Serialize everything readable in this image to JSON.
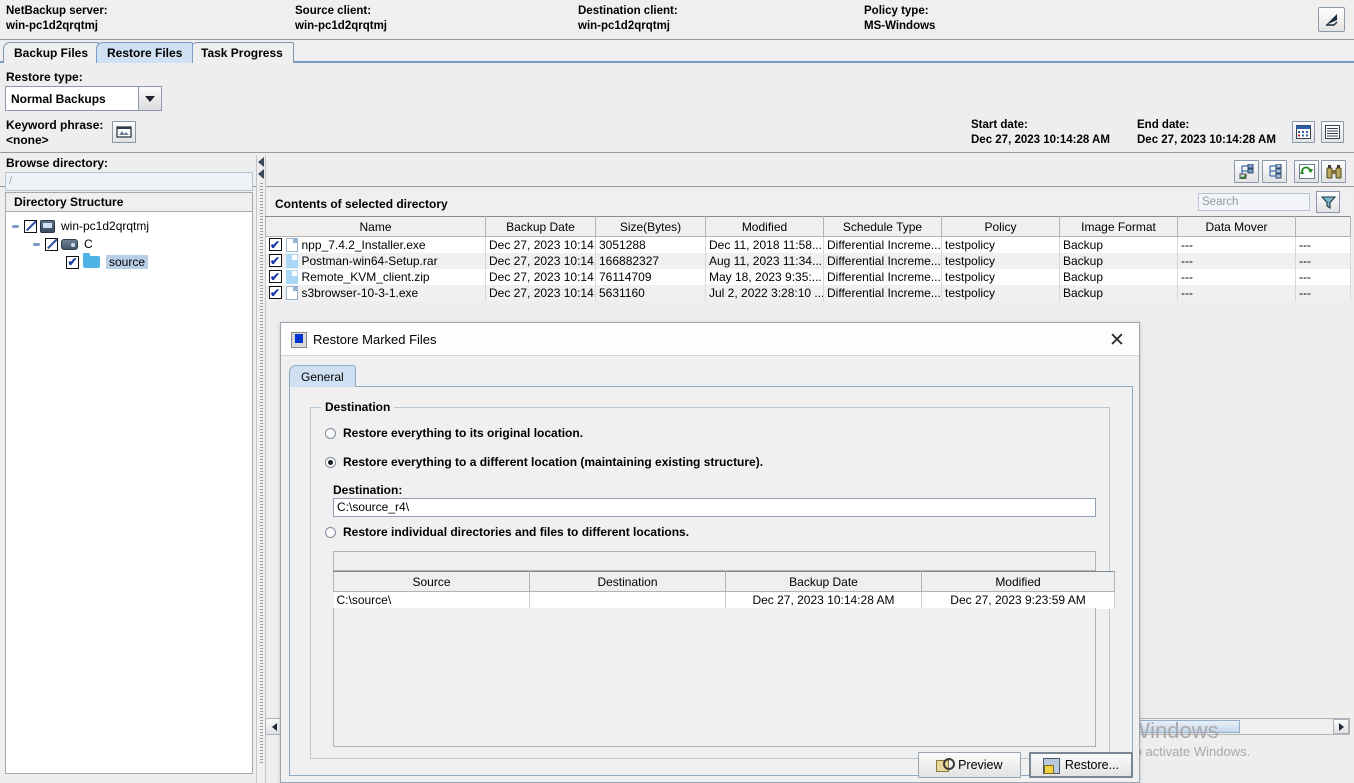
{
  "header": {
    "fields": [
      {
        "label": "NetBackup server:",
        "value": "win-pc1d2qrqtmj"
      },
      {
        "label": "Source client:",
        "value": "win-pc1d2qrqtmj"
      },
      {
        "label": "Destination client:",
        "value": "win-pc1d2qrqtmj"
      },
      {
        "label": "Policy type:",
        "value": "MS-Windows"
      }
    ],
    "expand_icon": "expand-arrow-icon"
  },
  "tabs": [
    {
      "label": "Backup Files",
      "active": false
    },
    {
      "label": "Restore Files",
      "active": true
    },
    {
      "label": "Task Progress",
      "active": false
    }
  ],
  "restore_type": {
    "label": "Restore type:",
    "selected": "Normal Backups",
    "options": [
      "Normal Backups"
    ]
  },
  "keyword": {
    "label": "Keyword phrase:",
    "value": "<none>",
    "button_icon": "keyword-icon"
  },
  "dates": {
    "start_label": "Start date:",
    "start_value": "Dec 27, 2023 10:14:28 AM",
    "end_label": "End date:",
    "end_value": "Dec 27, 2023 10:14:28 AM",
    "calendar_icon": "calendar-icon",
    "list_icon": "date-list-icon"
  },
  "toolbar": {
    "buttons": [
      "select-all-icon",
      "deselect-all-icon",
      "refresh-icon",
      "search-binoculars-icon"
    ]
  },
  "browse": {
    "label": "Browse directory:",
    "value": "/",
    "tree_header": "Directory Structure",
    "tree": [
      {
        "label": "win-pc1d2qrqtmj",
        "icon": "computer-icon",
        "state": "partial",
        "depth": 0,
        "selected": false
      },
      {
        "label": "C",
        "icon": "drive-icon",
        "state": "partial",
        "depth": 1,
        "selected": false
      },
      {
        "label": "source",
        "icon": "folder-icon",
        "state": "checked",
        "depth": 2,
        "selected": true
      }
    ]
  },
  "contents": {
    "title": "Contents of selected directory",
    "search_placeholder": "Search",
    "filter_icon": "filter-funnel-icon",
    "columns": [
      "Name",
      "Backup Date",
      "Size(Bytes)",
      "Modified",
      "Schedule Type",
      "Policy",
      "Image Format",
      "Data Mover",
      ""
    ],
    "rows": [
      {
        "checked": true,
        "icon": "file-exe-icon",
        "name": "npp_7.4.2_Installer.exe",
        "backup_date": "Dec 27, 2023 10:14...",
        "size": "3051288",
        "modified": "Dec 11, 2018 11:58...",
        "schedule_type": "Differential Increme...",
        "policy": "testpolicy",
        "image_format": "Backup",
        "data_mover": "---",
        "extra": "---"
      },
      {
        "checked": true,
        "icon": "file-archive-icon",
        "name": "Postman-win64-Setup.rar",
        "backup_date": "Dec 27, 2023 10:14...",
        "size": "166882327",
        "modified": "Aug 11, 2023 11:34...",
        "schedule_type": "Differential Increme...",
        "policy": "testpolicy",
        "image_format": "Backup",
        "data_mover": "---",
        "extra": "---"
      },
      {
        "checked": true,
        "icon": "file-archive-icon",
        "name": "Remote_KVM_client.zip",
        "backup_date": "Dec 27, 2023 10:14...",
        "size": "76114709",
        "modified": "May 18, 2023 9:35:...",
        "schedule_type": "Differential Increme...",
        "policy": "testpolicy",
        "image_format": "Backup",
        "data_mover": "---",
        "extra": "---"
      },
      {
        "checked": true,
        "icon": "file-exe-icon",
        "name": "s3browser-10-3-1.exe",
        "backup_date": "Dec 27, 2023 10:14...",
        "size": "5631160",
        "modified": "Jul 2, 2022 3:28:10 ...",
        "schedule_type": "Differential Increme...",
        "policy": "testpolicy",
        "image_format": "Backup",
        "data_mover": "---",
        "extra": "---"
      }
    ]
  },
  "dialog": {
    "title": "Restore Marked Files",
    "title_icon": "restore-window-icon",
    "close_icon": "close-icon",
    "tabs": [
      {
        "label": "General",
        "active": true
      }
    ],
    "group_legend": "Destination",
    "options": [
      {
        "label": "Restore everything to its original location.",
        "selected": false
      },
      {
        "label": "Restore everything to a different location (maintaining existing structure).",
        "selected": true
      },
      {
        "label": "Restore individual directories and files to different locations.",
        "selected": false
      }
    ],
    "destination_label": "Destination:",
    "destination_value": "C:\\source_r4\\",
    "table": {
      "columns": [
        "Source",
        "Destination",
        "Backup Date",
        "Modified"
      ],
      "rows": [
        {
          "source": "C:\\source\\",
          "destination": "",
          "backup_date": "Dec 27, 2023 10:14:28 AM",
          "modified": "Dec 27, 2023 9:23:59 AM"
        }
      ]
    },
    "buttons": [
      {
        "label": "Preview",
        "icon": "preview-icon",
        "focused": false
      },
      {
        "label": "Restore...",
        "icon": "restore-icon",
        "focused": true
      }
    ]
  },
  "watermark": {
    "line1": "Activate Windows",
    "line2": "Go to Settings to activate Windows."
  },
  "colors": {
    "tab_active": "#cfe0f2",
    "panel_bg": "#efefef",
    "accent_border": "#7a9cc6",
    "selection": "#b8cfe6"
  }
}
